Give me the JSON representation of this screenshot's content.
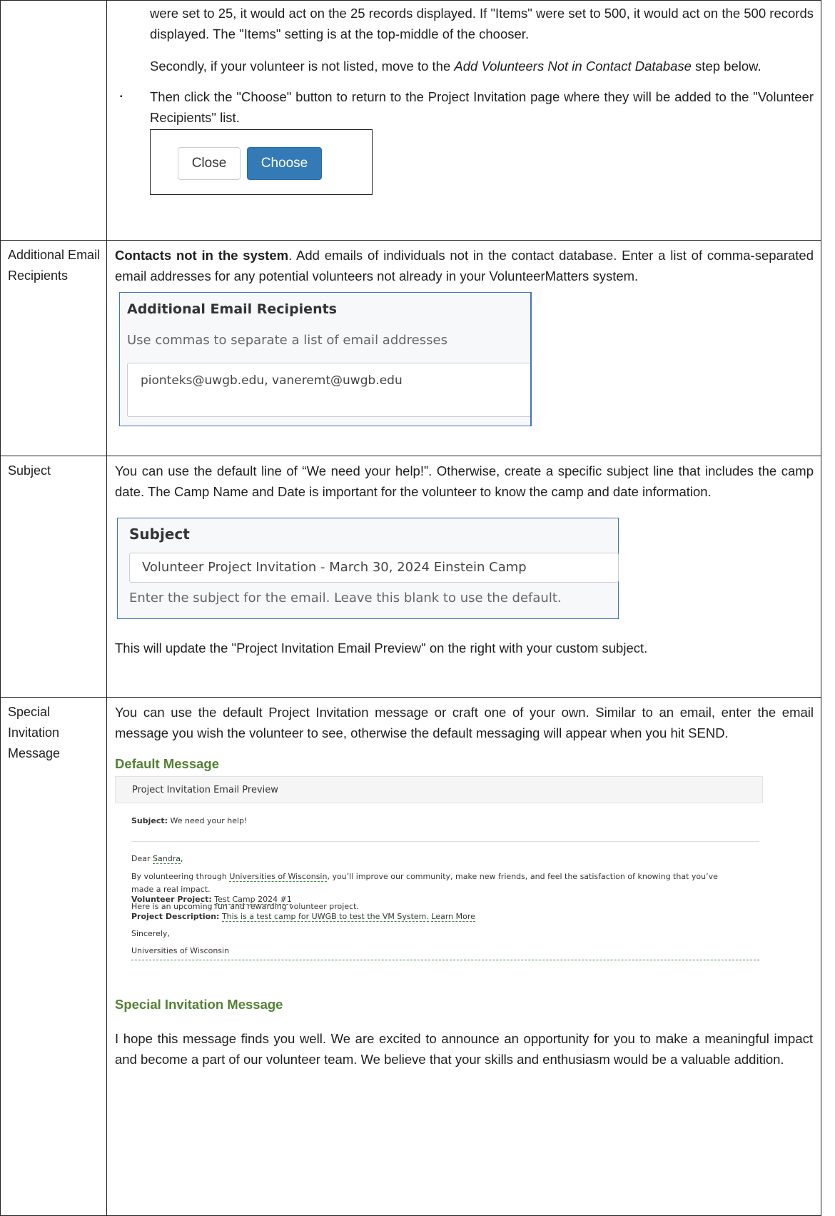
{
  "row1": {
    "p1": "were set to 25, it would act on the 25 records displayed. If \"Items\" were set to 500, it would act on the 500 records displayed. The \"Items\" setting is at the top-middle of the chooser.",
    "p2_prefix": "Secondly, if your volunteer is not listed, move to the ",
    "p2_italic": "Add Volunteers Not in Contact Database",
    "p2_suffix": " step below.",
    "bullet_glyph": "▪",
    "bullet_text": "Then click the \"Choose\" button to return to the Project Invitation page where they will be added to the \"Volunteer Recipients\" list.",
    "close_label": "Close",
    "choose_label": "Choose"
  },
  "row2": {
    "label": "Additional Email Recipients",
    "bold": "Contacts not in the system",
    "text": ".  Add emails of individuals not in the contact database.  Enter a list of comma-separated email addresses for any potential volunteers not already in your VolunteerMatters system.",
    "panel_title": "Additional Email Recipients",
    "panel_help": "Use commas to separate a list of email addresses",
    "panel_value": "pionteks@uwgb.edu, vaneremt@uwgb.edu"
  },
  "row3": {
    "label": "Subject",
    "text": "You can use the default line of “We need your help!”.  Otherwise, create a specific subject line that includes the camp date.  The Camp Name and Date is important for the volunteer to know the camp and date information.",
    "panel_title": "Subject",
    "panel_value": "Volunteer Project Invitation - March 30, 2024 Einstein Camp",
    "panel_help": "Enter the subject for the email. Leave this blank to use the default.",
    "after": "This will update the \"Project Invitation Email Preview\" on the right with your custom subject."
  },
  "row4": {
    "label": "Special Invitation Message",
    "text": "You can use the default Project Invitation message or craft one of your own.  Similar to an email, enter the email message you wish the volunteer to see, otherwise the default messaging will appear when you hit SEND.",
    "default_heading": "Default Message",
    "preview": {
      "header": "Project Invitation Email Preview",
      "subject_label": "Subject:",
      "subject_value": "We need your help!",
      "dear": "Dear ",
      "name": "Sandra",
      "comma": ",",
      "line1a": "By volunteering through ",
      "org": "Universities of Wisconsin",
      "line1b": ", you’ll improve our community, make new friends, and feel the satisfaction of knowing that you’ve",
      "line1c": "made a real impact.",
      "line2": "Here is an upcoming fun and rewarding volunteer project.",
      "project_label": "Volunteer Project:",
      "project_value": "Test Camp 2024 #1",
      "desc_label": "Project Description:",
      "desc_value": "This is a test camp for UWGB to test the VM System.",
      "learn_more": "Learn More",
      "sincerely": "Sincerely,",
      "signature": "Universities of Wisconsin"
    },
    "special_heading": "Special Invitation Message",
    "special_text": "I hope this message finds you well. We are excited to announce an opportunity for you to make a meaningful impact and become a part of our volunteer team. We believe that your skills and enthusiasm would be a valuable addition."
  }
}
